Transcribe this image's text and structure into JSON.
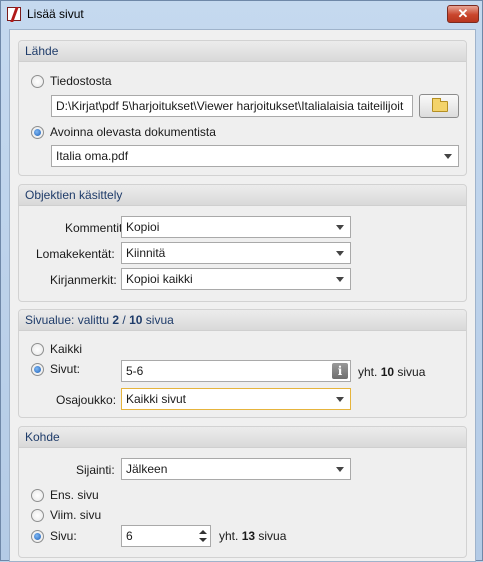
{
  "window": {
    "title": "Lisää sivut",
    "close_glyph": "✕"
  },
  "source": {
    "header": "Lähde",
    "from_file_label": "Tiedostosta",
    "file_path": "D:\\Kirjat\\pdf 5\\harjoitukset\\Viewer harjoitukset\\Italialaisia taiteilijoit",
    "open_doc_label": "Avoinna olevasta dokumentista",
    "open_doc_value": "Italia oma.pdf",
    "selected": "open_doc"
  },
  "objects": {
    "header": "Objektien käsittely",
    "comments_label": "Kommentit:",
    "comments_value": "Kopioi",
    "formfields_label": "Lomakekentät:",
    "formfields_value": "Kiinnitä",
    "bookmarks_label": "Kirjanmerkit:",
    "bookmarks_value": "Kopioi kaikki"
  },
  "range": {
    "header_prefix": "Sivualue: valittu ",
    "selected_count": "2",
    "header_sep": " / ",
    "total_count": "10",
    "header_suffix": " sivua",
    "all_label": "Kaikki",
    "pages_label": "Sivut:",
    "pages_value": "5-6",
    "total_prefix": "yht. ",
    "total_pages": "10",
    "total_suffix": " sivua",
    "subset_label": "Osajoukko:",
    "subset_value": "Kaikki sivut",
    "selected": "pages"
  },
  "target": {
    "header": "Kohde",
    "position_label": "Sijainti:",
    "position_value": "Jälkeen",
    "first_label": "Ens. sivu",
    "last_label": "Viim. sivu",
    "page_label": "Sivu:",
    "page_value": "6",
    "total_prefix": "yht. ",
    "total_pages": "13",
    "total_suffix": " sivua",
    "selected": "page"
  },
  "icons": [
    "app-icon",
    "close-icon",
    "folder-icon",
    "info-icon",
    "dropdown-arrow-icon",
    "spinner-icon"
  ],
  "colors": {
    "title_bg": "#bcd2ea",
    "close_red": "#c9452c",
    "group_header_text": "#1f3c6a",
    "focus_border": "#e6b43c"
  }
}
